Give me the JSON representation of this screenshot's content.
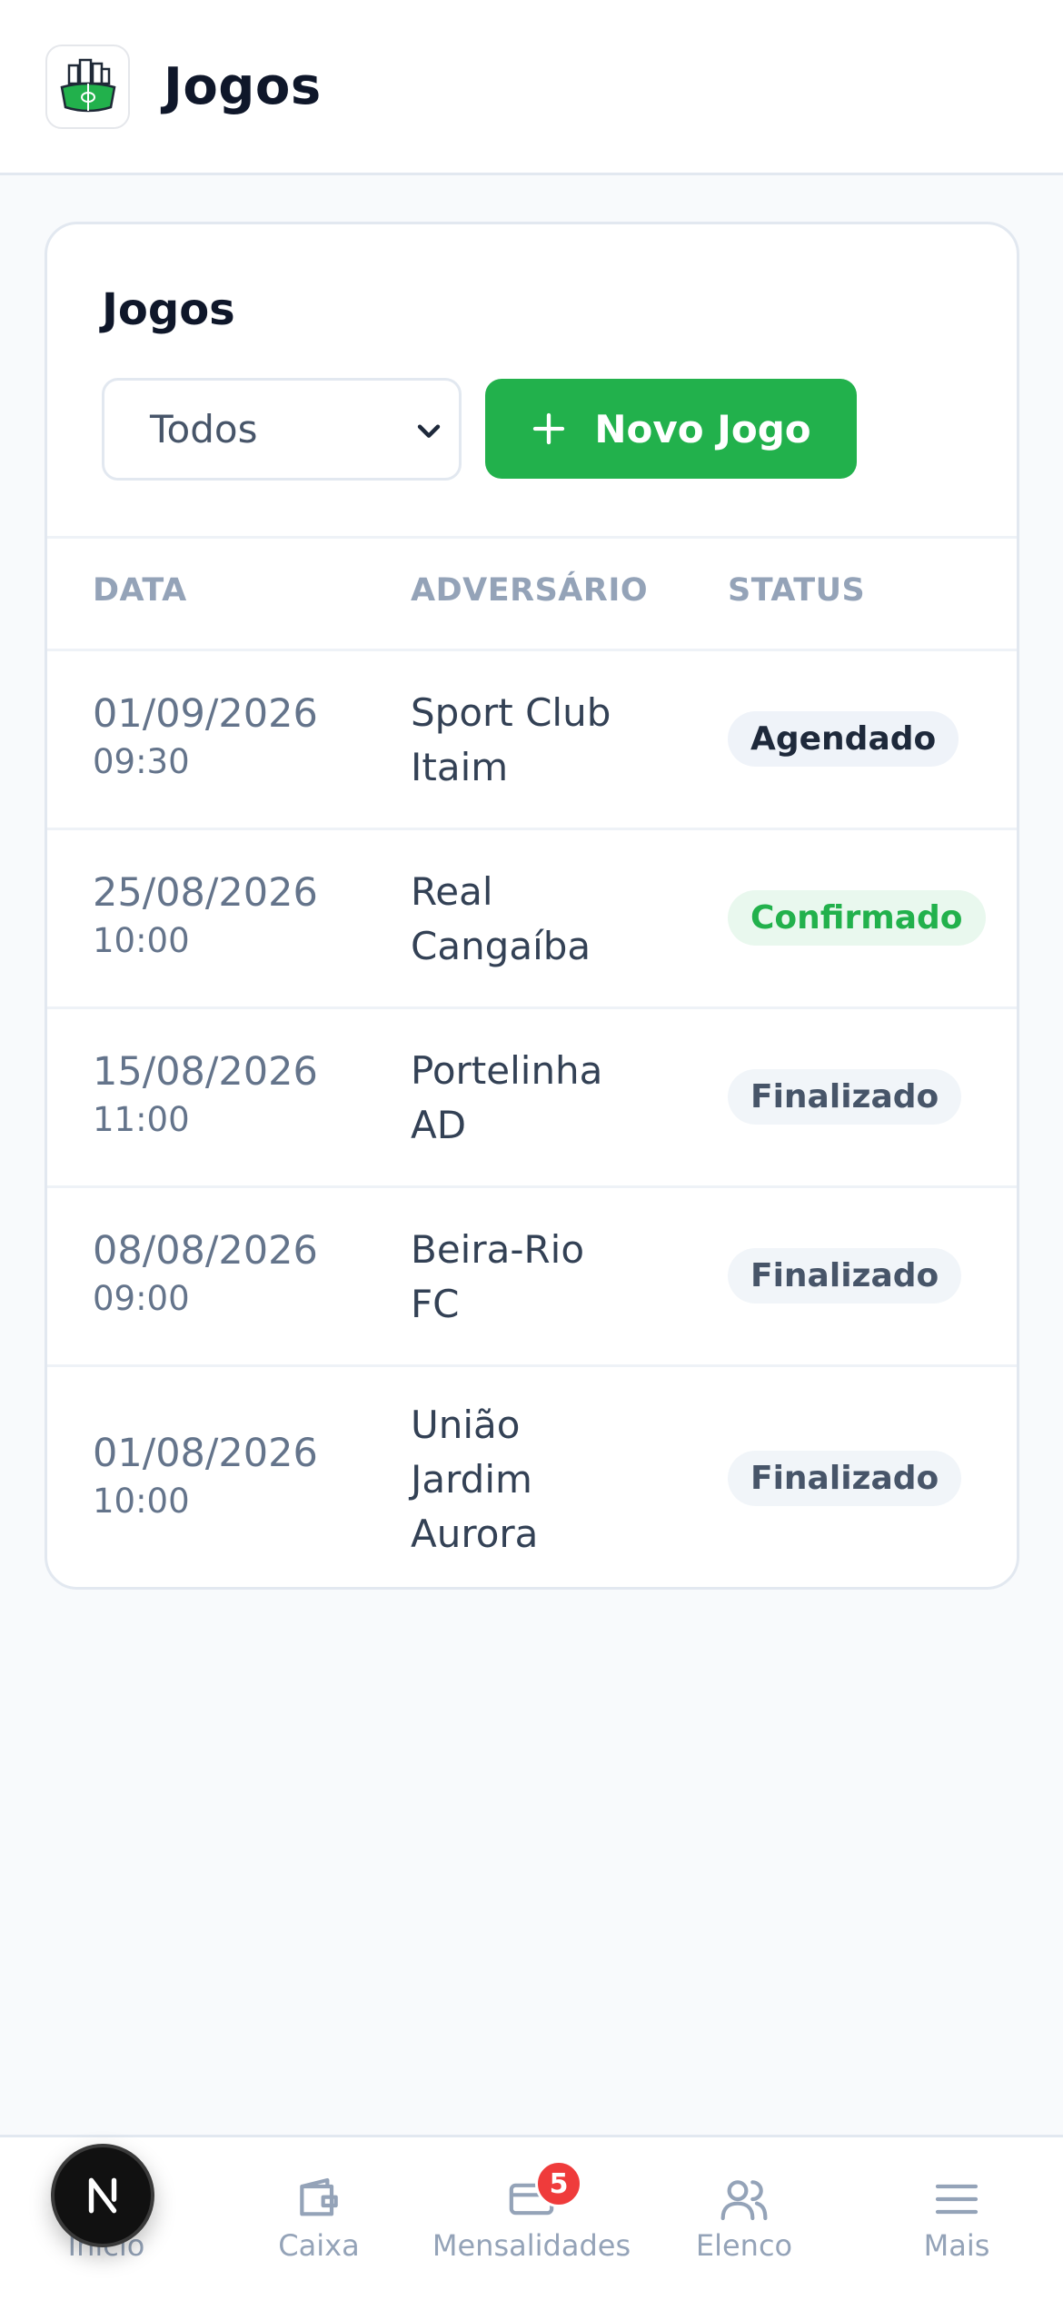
{
  "header": {
    "title": "Jogos",
    "logo_icon": "soccer-stadium-logo"
  },
  "card": {
    "title": "Jogos",
    "filter": {
      "selected": "Todos"
    },
    "new_button_label": "Novo Jogo",
    "columns": [
      "DATA",
      "ADVERSÁRIO",
      "STATUS"
    ],
    "rows": [
      {
        "date": "01/09/2026",
        "time": "09:30",
        "opponent_lines": [
          "Sport Club",
          "Itaim"
        ],
        "status": "Agendado",
        "status_type": "agendado"
      },
      {
        "date": "25/08/2026",
        "time": "10:00",
        "opponent_lines": [
          "Real",
          "Cangaíba"
        ],
        "status": "Confirmado",
        "status_type": "confirmado"
      },
      {
        "date": "15/08/2026",
        "time": "11:00",
        "opponent_lines": [
          "Portelinha",
          "AD"
        ],
        "status": "Finalizado",
        "status_type": "finalizado"
      },
      {
        "date": "08/08/2026",
        "time": "09:00",
        "opponent_lines": [
          "Beira-Rio",
          "FC"
        ],
        "status": "Finalizado",
        "status_type": "finalizado"
      },
      {
        "date": "01/08/2026",
        "time": "10:00",
        "opponent_lines": [
          "União",
          "Jardim",
          "Aurora"
        ],
        "status": "Finalizado",
        "status_type": "finalizado"
      }
    ]
  },
  "bottom_nav": {
    "items": [
      {
        "label": "Início",
        "icon": "home-icon"
      },
      {
        "label": "Caixa",
        "icon": "wallet-icon"
      },
      {
        "label": "Mensalidades",
        "icon": "credit-card-icon"
      },
      {
        "label": "Elenco",
        "icon": "users-icon"
      },
      {
        "label": "Mais",
        "icon": "menu-icon"
      }
    ],
    "mensalidades_badge": "5"
  },
  "dev_indicator": {
    "letter": "N"
  },
  "colors": {
    "primary_green": "#22b14c",
    "badge_red": "#ef3b3b"
  }
}
